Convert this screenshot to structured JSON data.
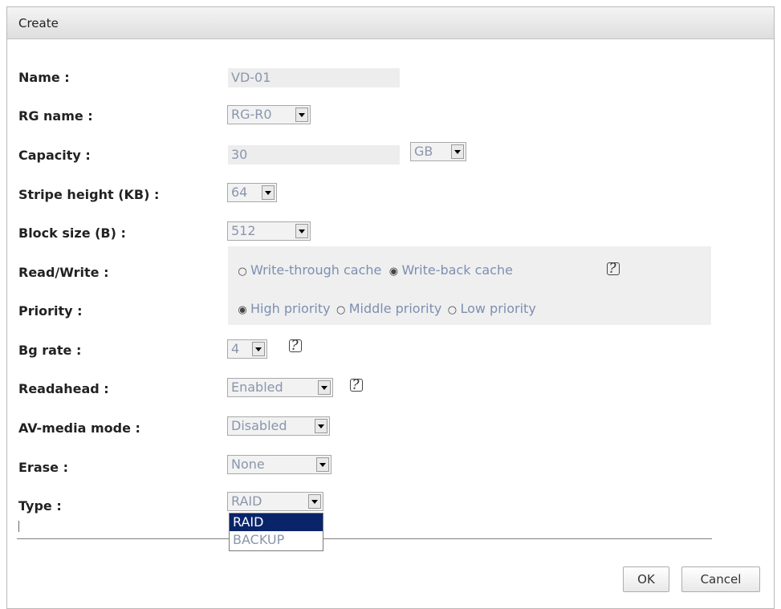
{
  "dialog": {
    "title": "Create"
  },
  "fields": {
    "name": {
      "label": "Name :",
      "value": "VD-01"
    },
    "rg_name": {
      "label": "RG name :",
      "value": "RG-R0"
    },
    "capacity": {
      "label": "Capacity :",
      "value": "30",
      "unit": "GB"
    },
    "stripe_height": {
      "label": "Stripe height (KB) :",
      "value": "64"
    },
    "block_size": {
      "label": "Block size (B) :",
      "value": "512"
    },
    "read_write": {
      "label": "Read/Write :",
      "options": [
        "Write-through cache",
        "Write-back cache"
      ],
      "selected": "Write-back cache"
    },
    "priority": {
      "label": "Priority :",
      "options": [
        "High priority",
        "Middle priority",
        "Low priority"
      ],
      "selected": "High priority"
    },
    "bg_rate": {
      "label": "Bg rate :",
      "value": "4"
    },
    "readahead": {
      "label": "Readahead :",
      "value": "Enabled"
    },
    "av_media_mode": {
      "label": "AV-media mode :",
      "value": "Disabled"
    },
    "erase": {
      "label": "Erase :",
      "value": "None"
    },
    "type": {
      "label": "Type :",
      "value": "RAID",
      "dropdown_options": [
        "RAID",
        "BACKUP"
      ],
      "highlighted": "RAID"
    }
  },
  "buttons": {
    "ok": "OK",
    "cancel": "Cancel"
  },
  "icons": {
    "help": "help-icon",
    "radio_checked": "◉",
    "radio_unchecked": "○"
  },
  "colors": {
    "value_text": "#8a96ad",
    "option_text": "#7d8fb1",
    "dropdown_highlight": "#0a246a",
    "panel_bg": "#efefef"
  }
}
